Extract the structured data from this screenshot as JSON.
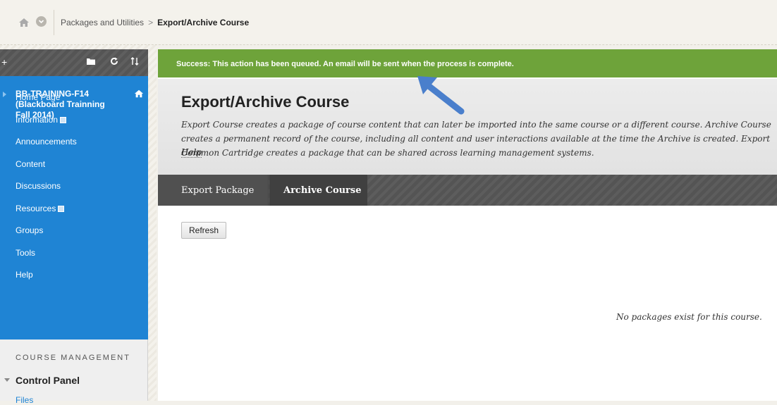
{
  "breadcrumb": {
    "parent": "Packages and Utilities",
    "separator": ">",
    "current": "Export/Archive Course"
  },
  "sidebar": {
    "course_title": "BB-TRAINING-F14 (Blackboard Trainning Fall 2014)",
    "items": [
      {
        "label": "Home Page",
        "has_box": false
      },
      {
        "label": "Information",
        "has_box": true
      },
      {
        "label": "Announcements",
        "has_box": false
      },
      {
        "label": "Content",
        "has_box": false
      },
      {
        "label": "Discussions",
        "has_box": false
      },
      {
        "label": "Resources",
        "has_box": true
      },
      {
        "label": "Groups",
        "has_box": false
      },
      {
        "label": "Tools",
        "has_box": false
      },
      {
        "label": "Help",
        "has_box": false
      }
    ],
    "management_heading": "COURSE MANAGEMENT",
    "control_panel": "Control Panel",
    "files": "Files"
  },
  "success_message": "Success: This action has been queued. An email will be sent when the process is complete.",
  "page": {
    "title": "Export/Archive Course",
    "description": "Export Course creates a package of course content that can later be imported into the same course or a different course. Archive Course creates a permanent record of the course, including all content and user interactions available at the time the Archive is created. Export Common Cartridge creates a package that can be shared across learning management systems.",
    "help": "Help"
  },
  "tabs": [
    "Export Package",
    "Archive Course"
  ],
  "refresh_label": "Refresh",
  "empty_message": "No packages exist for this course.",
  "colors": {
    "sidebar": "#1f84d4",
    "success": "#6ea33a",
    "arrow": "#4a7fcc"
  }
}
